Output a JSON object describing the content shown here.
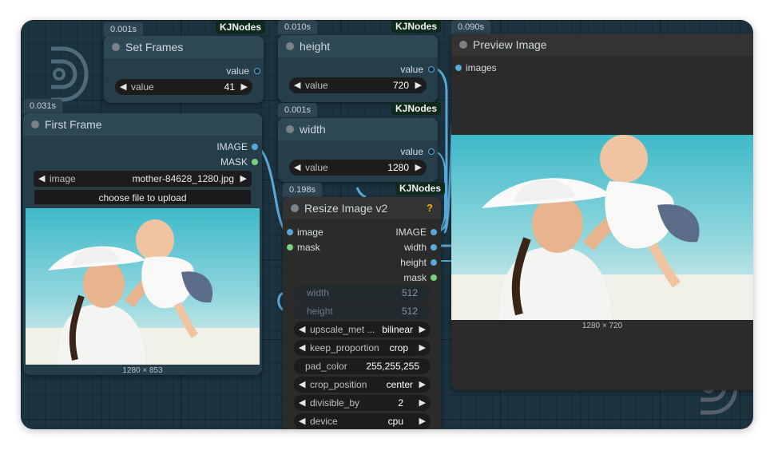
{
  "brand_badge": "KJNodes",
  "set_frames": {
    "timing": "0.001s",
    "title": "Set Frames",
    "output": "value",
    "widget_label": "value",
    "widget_value": "41"
  },
  "height_node": {
    "timing": "0.010s",
    "title": "height",
    "output": "value",
    "widget_label": "value",
    "widget_value": "720"
  },
  "width_node": {
    "timing": "0.001s",
    "title": "width",
    "output": "value",
    "widget_label": "value",
    "widget_value": "1280"
  },
  "first_frame": {
    "timing": "0.031s",
    "title": "First Frame",
    "outputs": [
      "IMAGE",
      "MASK"
    ],
    "image_label": "image",
    "image_value": "mother-84628_1280.jpg",
    "upload_label": "choose file to upload",
    "caption": "1280 × 853"
  },
  "resize": {
    "timing": "0.198s",
    "title": "Resize Image v2",
    "help": "?",
    "inputs": [
      "image",
      "mask"
    ],
    "outputs": [
      "IMAGE",
      "width",
      "height",
      "mask"
    ],
    "width_label": "width",
    "width_value": "512",
    "height_label": "height",
    "height_value": "512",
    "upscale_label": "upscale_met ...",
    "upscale_value": "bilinear",
    "keep_label": "keep_proportion",
    "keep_value": "crop",
    "pad_label": "pad_color",
    "pad_value": "255,255,255",
    "crop_label": "crop_position",
    "crop_value": "center",
    "div_label": "divisible_by",
    "div_value": "2",
    "device_label": "device",
    "device_value": "cpu"
  },
  "preview": {
    "timing": "0.090s",
    "title": "Preview Image",
    "input": "images",
    "caption": "1280 × 720"
  },
  "colors": {
    "canvas": "#1c3340",
    "wire": "#5aa8d8",
    "mask_socket": "#7ad07a",
    "badge_bg": "#0f2a1d"
  }
}
